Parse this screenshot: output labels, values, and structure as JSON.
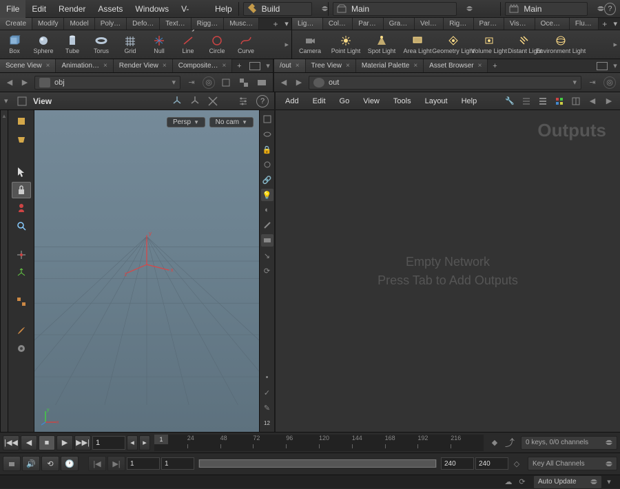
{
  "menubar": [
    "File",
    "Edit",
    "Render",
    "Assets",
    "Windows",
    "V-Ray",
    "Help"
  ],
  "desktop_dropdown": "Build",
  "take_dropdown1": "Main",
  "take_dropdown2": "Main",
  "help_glyph": "?",
  "shelf_tabs_left": [
    "Create",
    "Modify",
    "Model",
    "Poly…",
    "Defo…",
    "Text…",
    "Rigg…",
    "Musc…"
  ],
  "shelf_tabs_right": [
    "Ligh…",
    "Coll…",
    "Part…",
    "Grains",
    "Vell…",
    "Rigi…",
    "Part…",
    "Visc…",
    "Oceans",
    "Flui…"
  ],
  "shelf_tools_left": [
    {
      "label": "Box",
      "icon": "box"
    },
    {
      "label": "Sphere",
      "icon": "sphere"
    },
    {
      "label": "Tube",
      "icon": "tube"
    },
    {
      "label": "Torus",
      "icon": "torus"
    },
    {
      "label": "Grid",
      "icon": "grid"
    },
    {
      "label": "Null",
      "icon": "null"
    },
    {
      "label": "Line",
      "icon": "line"
    },
    {
      "label": "Circle",
      "icon": "circle"
    },
    {
      "label": "Curve",
      "icon": "curve"
    }
  ],
  "shelf_tools_right": [
    {
      "label": "Camera",
      "icon": "camera"
    },
    {
      "label": "Point Light",
      "icon": "pointlight"
    },
    {
      "label": "Spot Light",
      "icon": "spotlight"
    },
    {
      "label": "Area Light",
      "icon": "arealight"
    },
    {
      "label": "Geometry Light",
      "icon": "geolight"
    },
    {
      "label": "Volume Light",
      "icon": "vollight"
    },
    {
      "label": "Distant Light",
      "icon": "distlight"
    },
    {
      "label": "Environment Light",
      "icon": "envlight"
    }
  ],
  "left_pane_tabs": [
    "Scene View",
    "Animation…",
    "Render View",
    "Composite…"
  ],
  "right_pane_tabs": [
    "/out",
    "Tree View",
    "Material Palette",
    "Asset Browser"
  ],
  "left_path": "obj",
  "right_path": "out",
  "view_label": "View",
  "persp_pill": "Persp",
  "cam_pill": "No cam",
  "net_menus": [
    "Add",
    "Edit",
    "Go",
    "View",
    "Tools",
    "Layout",
    "Help"
  ],
  "net_heading": "Outputs",
  "net_empty1": "Empty Network",
  "net_empty2": "Press Tab to Add Outputs",
  "timeline": {
    "frame_field": "1",
    "marker": "1",
    "ticks": [
      "24",
      "48",
      "72",
      "96",
      "120",
      "144",
      "168",
      "192",
      "216"
    ],
    "keys_text": "0 keys, 0/0 channels",
    "key_all": "Key All Channels",
    "range_start_a": "1",
    "range_start_b": "1",
    "range_end_a": "240",
    "range_end_b": "240",
    "auto_update": "Auto Update"
  }
}
